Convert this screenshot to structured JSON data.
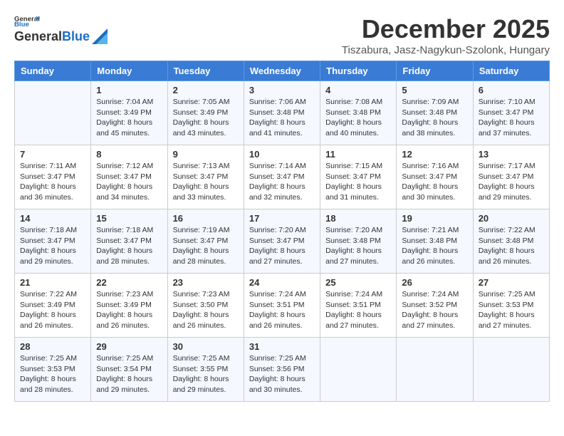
{
  "header": {
    "logo_general": "General",
    "logo_blue": "Blue",
    "month_title": "December 2025",
    "location": "Tiszabura, Jasz-Nagykun-Szolonk, Hungary"
  },
  "calendar": {
    "days_of_week": [
      "Sunday",
      "Monday",
      "Tuesday",
      "Wednesday",
      "Thursday",
      "Friday",
      "Saturday"
    ],
    "weeks": [
      [
        {
          "day": "",
          "sunrise": "",
          "sunset": "",
          "daylight": ""
        },
        {
          "day": "1",
          "sunrise": "Sunrise: 7:04 AM",
          "sunset": "Sunset: 3:49 PM",
          "daylight": "Daylight: 8 hours and 45 minutes."
        },
        {
          "day": "2",
          "sunrise": "Sunrise: 7:05 AM",
          "sunset": "Sunset: 3:49 PM",
          "daylight": "Daylight: 8 hours and 43 minutes."
        },
        {
          "day": "3",
          "sunrise": "Sunrise: 7:06 AM",
          "sunset": "Sunset: 3:48 PM",
          "daylight": "Daylight: 8 hours and 41 minutes."
        },
        {
          "day": "4",
          "sunrise": "Sunrise: 7:08 AM",
          "sunset": "Sunset: 3:48 PM",
          "daylight": "Daylight: 8 hours and 40 minutes."
        },
        {
          "day": "5",
          "sunrise": "Sunrise: 7:09 AM",
          "sunset": "Sunset: 3:48 PM",
          "daylight": "Daylight: 8 hours and 38 minutes."
        },
        {
          "day": "6",
          "sunrise": "Sunrise: 7:10 AM",
          "sunset": "Sunset: 3:47 PM",
          "daylight": "Daylight: 8 hours and 37 minutes."
        }
      ],
      [
        {
          "day": "7",
          "sunrise": "Sunrise: 7:11 AM",
          "sunset": "Sunset: 3:47 PM",
          "daylight": "Daylight: 8 hours and 36 minutes."
        },
        {
          "day": "8",
          "sunrise": "Sunrise: 7:12 AM",
          "sunset": "Sunset: 3:47 PM",
          "daylight": "Daylight: 8 hours and 34 minutes."
        },
        {
          "day": "9",
          "sunrise": "Sunrise: 7:13 AM",
          "sunset": "Sunset: 3:47 PM",
          "daylight": "Daylight: 8 hours and 33 minutes."
        },
        {
          "day": "10",
          "sunrise": "Sunrise: 7:14 AM",
          "sunset": "Sunset: 3:47 PM",
          "daylight": "Daylight: 8 hours and 32 minutes."
        },
        {
          "day": "11",
          "sunrise": "Sunrise: 7:15 AM",
          "sunset": "Sunset: 3:47 PM",
          "daylight": "Daylight: 8 hours and 31 minutes."
        },
        {
          "day": "12",
          "sunrise": "Sunrise: 7:16 AM",
          "sunset": "Sunset: 3:47 PM",
          "daylight": "Daylight: 8 hours and 30 minutes."
        },
        {
          "day": "13",
          "sunrise": "Sunrise: 7:17 AM",
          "sunset": "Sunset: 3:47 PM",
          "daylight": "Daylight: 8 hours and 29 minutes."
        }
      ],
      [
        {
          "day": "14",
          "sunrise": "Sunrise: 7:18 AM",
          "sunset": "Sunset: 3:47 PM",
          "daylight": "Daylight: 8 hours and 29 minutes."
        },
        {
          "day": "15",
          "sunrise": "Sunrise: 7:18 AM",
          "sunset": "Sunset: 3:47 PM",
          "daylight": "Daylight: 8 hours and 28 minutes."
        },
        {
          "day": "16",
          "sunrise": "Sunrise: 7:19 AM",
          "sunset": "Sunset: 3:47 PM",
          "daylight": "Daylight: 8 hours and 28 minutes."
        },
        {
          "day": "17",
          "sunrise": "Sunrise: 7:20 AM",
          "sunset": "Sunset: 3:47 PM",
          "daylight": "Daylight: 8 hours and 27 minutes."
        },
        {
          "day": "18",
          "sunrise": "Sunrise: 7:20 AM",
          "sunset": "Sunset: 3:48 PM",
          "daylight": "Daylight: 8 hours and 27 minutes."
        },
        {
          "day": "19",
          "sunrise": "Sunrise: 7:21 AM",
          "sunset": "Sunset: 3:48 PM",
          "daylight": "Daylight: 8 hours and 26 minutes."
        },
        {
          "day": "20",
          "sunrise": "Sunrise: 7:22 AM",
          "sunset": "Sunset: 3:48 PM",
          "daylight": "Daylight: 8 hours and 26 minutes."
        }
      ],
      [
        {
          "day": "21",
          "sunrise": "Sunrise: 7:22 AM",
          "sunset": "Sunset: 3:49 PM",
          "daylight": "Daylight: 8 hours and 26 minutes."
        },
        {
          "day": "22",
          "sunrise": "Sunrise: 7:23 AM",
          "sunset": "Sunset: 3:49 PM",
          "daylight": "Daylight: 8 hours and 26 minutes."
        },
        {
          "day": "23",
          "sunrise": "Sunrise: 7:23 AM",
          "sunset": "Sunset: 3:50 PM",
          "daylight": "Daylight: 8 hours and 26 minutes."
        },
        {
          "day": "24",
          "sunrise": "Sunrise: 7:24 AM",
          "sunset": "Sunset: 3:51 PM",
          "daylight": "Daylight: 8 hours and 26 minutes."
        },
        {
          "day": "25",
          "sunrise": "Sunrise: 7:24 AM",
          "sunset": "Sunset: 3:51 PM",
          "daylight": "Daylight: 8 hours and 27 minutes."
        },
        {
          "day": "26",
          "sunrise": "Sunrise: 7:24 AM",
          "sunset": "Sunset: 3:52 PM",
          "daylight": "Daylight: 8 hours and 27 minutes."
        },
        {
          "day": "27",
          "sunrise": "Sunrise: 7:25 AM",
          "sunset": "Sunset: 3:53 PM",
          "daylight": "Daylight: 8 hours and 27 minutes."
        }
      ],
      [
        {
          "day": "28",
          "sunrise": "Sunrise: 7:25 AM",
          "sunset": "Sunset: 3:53 PM",
          "daylight": "Daylight: 8 hours and 28 minutes."
        },
        {
          "day": "29",
          "sunrise": "Sunrise: 7:25 AM",
          "sunset": "Sunset: 3:54 PM",
          "daylight": "Daylight: 8 hours and 29 minutes."
        },
        {
          "day": "30",
          "sunrise": "Sunrise: 7:25 AM",
          "sunset": "Sunset: 3:55 PM",
          "daylight": "Daylight: 8 hours and 29 minutes."
        },
        {
          "day": "31",
          "sunrise": "Sunrise: 7:25 AM",
          "sunset": "Sunset: 3:56 PM",
          "daylight": "Daylight: 8 hours and 30 minutes."
        },
        {
          "day": "",
          "sunrise": "",
          "sunset": "",
          "daylight": ""
        },
        {
          "day": "",
          "sunrise": "",
          "sunset": "",
          "daylight": ""
        },
        {
          "day": "",
          "sunrise": "",
          "sunset": "",
          "daylight": ""
        }
      ]
    ]
  }
}
